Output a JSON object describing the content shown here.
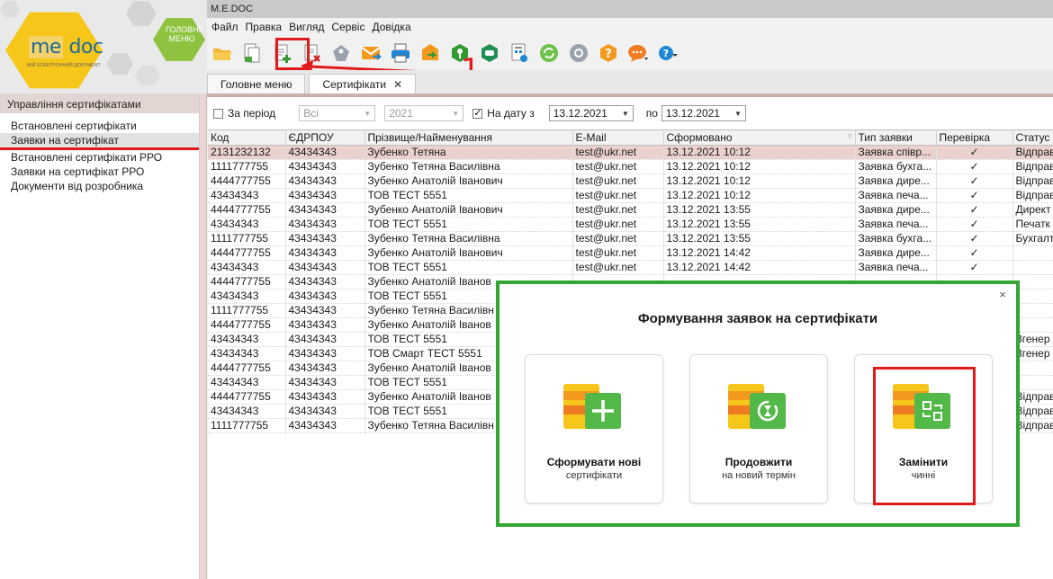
{
  "brand": {
    "logo_left": "me",
    "logo_right": "doc",
    "tagline": "мій електронний документ",
    "main_menu": "ГОЛОВНЕ МЕНЮ"
  },
  "window": {
    "title": "M.E.DOC"
  },
  "menu": [
    "Файл",
    "Правка",
    "Вигляд",
    "Сервіс",
    "Довідка"
  ],
  "toolbar": {
    "icons": [
      "folder-open-icon",
      "copy-docs-icon",
      "add-doc-icon",
      "delete-doc-icon",
      "tag-icon",
      "mail-icon",
      "print-icon",
      "export-icon",
      "key-icon",
      "shield-icon",
      "calc-icon",
      "refresh-icon",
      "settings-icon",
      "help-icon",
      "chat-icon",
      "info-icon"
    ],
    "annotation_number": "1"
  },
  "tabs": [
    {
      "label": "Головне меню",
      "closable": false,
      "active": false
    },
    {
      "label": "Сертифікати",
      "closable": true,
      "active": true
    }
  ],
  "sidebar": {
    "title": "Управління сертифікатами",
    "items": [
      {
        "label": "Встановлені сертифікати",
        "selected": false
      },
      {
        "label": "Заявки на сертифікат",
        "selected": true
      },
      {
        "label": "Встановлені сертифікати РРО",
        "selected": false
      },
      {
        "label": "Заявки на сертифікат РРО",
        "selected": false
      },
      {
        "label": "Документи від розробника",
        "selected": false
      }
    ]
  },
  "filters": {
    "period_label": "За період",
    "period_checked": false,
    "type_value": "Всі",
    "year_value": "2021",
    "date_label": "На дату з",
    "date_checked": true,
    "date_from": "13.12.2021",
    "to_label": "по",
    "date_to": "13.12.2021"
  },
  "table": {
    "columns": [
      "Код",
      "ЄДРПОУ",
      "Прізвище/Найменування",
      "E-Mail",
      "Сформовано",
      "Тип заявки",
      "Перевірка",
      "Статус"
    ],
    "rows": [
      [
        "2131232132",
        "43434343",
        "Зубенко Тетяна",
        "test@ukr.net",
        "13.12.2021 10:12",
        "Заявка співр...",
        "✓",
        "Відправ"
      ],
      [
        "1111777755",
        "43434343",
        "Зубенко Тетяна Василівна",
        "test@ukr.net",
        "13.12.2021 10:12",
        "Заявка бухга...",
        "✓",
        "Відправ"
      ],
      [
        "4444777755",
        "43434343",
        "Зубенко Анатолій Іванович",
        "test@ukr.net",
        "13.12.2021 10:12",
        "Заявка дире...",
        "✓",
        "Відправ"
      ],
      [
        "43434343",
        "43434343",
        "ТОВ ТЕСТ 5551",
        "test@ukr.net",
        "13.12.2021 10:12",
        "Заявка печа...",
        "✓",
        "Відправ"
      ],
      [
        "4444777755",
        "43434343",
        "Зубенко Анатолій Іванович",
        "test@ukr.net",
        "13.12.2021 13:55",
        "Заявка дире...",
        "✓",
        "Директ"
      ],
      [
        "43434343",
        "43434343",
        "ТОВ ТЕСТ 5551",
        "test@ukr.net",
        "13.12.2021 13:55",
        "Заявка печа...",
        "✓",
        "Печатк"
      ],
      [
        "1111777755",
        "43434343",
        "Зубенко Тетяна Василівна",
        "test@ukr.net",
        "13.12.2021 13:55",
        "Заявка бухга...",
        "✓",
        "Бухгалт"
      ],
      [
        "4444777755",
        "43434343",
        "Зубенко Анатолій Іванович",
        "test@ukr.net",
        "13.12.2021 14:42",
        "Заявка дире...",
        "✓",
        ""
      ],
      [
        "43434343",
        "43434343",
        "ТОВ ТЕСТ 5551",
        "test@ukr.net",
        "13.12.2021 14:42",
        "Заявка печа...",
        "✓",
        ""
      ],
      [
        "4444777755",
        "43434343",
        "Зубенко Анатолій Іванов",
        "",
        "",
        "",
        "",
        ""
      ],
      [
        "43434343",
        "43434343",
        "ТОВ ТЕСТ 5551",
        "",
        "",
        "",
        "",
        ""
      ],
      [
        "1111777755",
        "43434343",
        "Зубенко Тетяна Василівн",
        "",
        "",
        "",
        "",
        ""
      ],
      [
        "4444777755",
        "43434343",
        "Зубенко Анатолій Іванов",
        "",
        "",
        "",
        "",
        ""
      ],
      [
        "43434343",
        "43434343",
        "ТОВ ТЕСТ 5551",
        "",
        "",
        "",
        "",
        "Згенер"
      ],
      [
        "43434343",
        "43434343",
        "ТОВ Смарт ТЕСТ 5551",
        "",
        "",
        "",
        "",
        "Згенер"
      ],
      [
        "4444777755",
        "43434343",
        "Зубенко Анатолій Іванов",
        "",
        "",
        "",
        "",
        ""
      ],
      [
        "43434343",
        "43434343",
        "ТОВ ТЕСТ 5551",
        "",
        "",
        "",
        "",
        ""
      ],
      [
        "4444777755",
        "43434343",
        "Зубенко Анатолій Іванов",
        "",
        "",
        "",
        "",
        "Відправ"
      ],
      [
        "43434343",
        "43434343",
        "ТОВ ТЕСТ 5551",
        "",
        "",
        "",
        "",
        "Відправ"
      ],
      [
        "1111777755",
        "43434343",
        "Зубенко Тетяна Василівн",
        "",
        "",
        "",
        "",
        "Відправ"
      ]
    ]
  },
  "dialog": {
    "title": "Формування заявок на сертифікати",
    "close": "×",
    "options": [
      {
        "main": "Сформувати нові",
        "sub": "сертифікати",
        "icon": "plus-icon"
      },
      {
        "main": "Продовжити",
        "sub": "на новий термін",
        "icon": "hourglass-icon"
      },
      {
        "main": "Замінити",
        "sub": "чинні",
        "icon": "replace-icon"
      }
    ]
  },
  "colors": {
    "highlight_red": "#e01a1a",
    "dialog_border_green": "#33a532",
    "selected_row": "#ead1ce",
    "card_orange": "#f39a1e",
    "card_green": "#52b848"
  }
}
